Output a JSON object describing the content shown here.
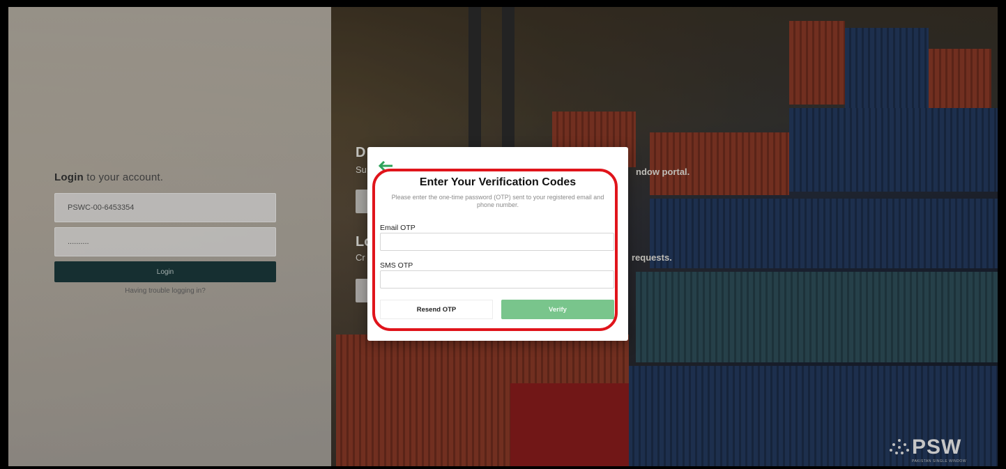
{
  "login": {
    "title_bold": "Login",
    "title_rest": " to your account.",
    "username_value": "PSWC-00-6453354",
    "password_value": "..........",
    "login_button": "Login",
    "trouble_link": "Having trouble logging in?"
  },
  "background": {
    "heading1_partial": "D",
    "sub1_left": "Su",
    "sub1_right": "ndow portal.",
    "heading2_partial": "Lo",
    "sub2_left": "Cr",
    "sub2_right": "requests."
  },
  "modal": {
    "back_icon": "arrow-left-icon",
    "title": "Enter Your Verification Codes",
    "description": "Please enter the one-time password (OTP) sent to your registered email and phone number.",
    "email_label": "Email OTP",
    "email_value": "",
    "sms_label": "SMS OTP",
    "sms_value": "",
    "resend_button": "Resend OTP",
    "verify_button": "Verify"
  },
  "brand": {
    "logo_text": "PSW",
    "logo_tagline": "PAKISTAN SINGLE WINDOW"
  },
  "colors": {
    "accent_green": "#2ea35a",
    "verify_green": "#79c58c",
    "login_button": "#1c3a3c",
    "highlight_red": "#e0141b"
  }
}
